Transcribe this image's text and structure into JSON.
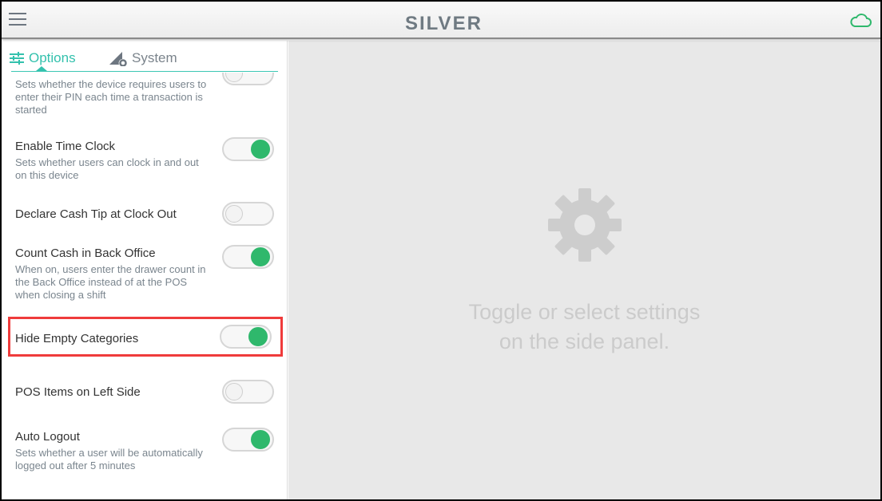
{
  "header": {
    "logo": "SILVER",
    "menu_icon": "hamburger-icon",
    "status_icon": "cloud-icon",
    "status_color": "#2fb86c"
  },
  "tabs": [
    {
      "label": "Options",
      "active": true
    },
    {
      "label": "System",
      "active": false
    }
  ],
  "accent": "#33c1ad",
  "settings": [
    {
      "title": "",
      "desc": "Sets whether the device requires users to enter their PIN each time a transaction is started",
      "on": false
    },
    {
      "title": "Enable Time Clock",
      "desc": "Sets whether users can clock in and out on this device",
      "on": true
    },
    {
      "title": "Declare Cash Tip at Clock Out",
      "desc": "",
      "on": false
    },
    {
      "title": "Count Cash in Back Office",
      "desc": "When on, users enter the drawer count in the Back Office instead of at the POS when closing a shift",
      "on": true
    },
    {
      "title": "Hide Empty Categories",
      "desc": "",
      "on": true,
      "highlighted": true
    },
    {
      "title": "POS Items on Left Side",
      "desc": "",
      "on": false
    },
    {
      "title": "Auto Logout",
      "desc": "Sets whether a user will be automatically logged out after 5 minutes",
      "on": true
    }
  ],
  "main": {
    "message_line1": "Toggle or select settings",
    "message_line2": "on the side panel."
  }
}
